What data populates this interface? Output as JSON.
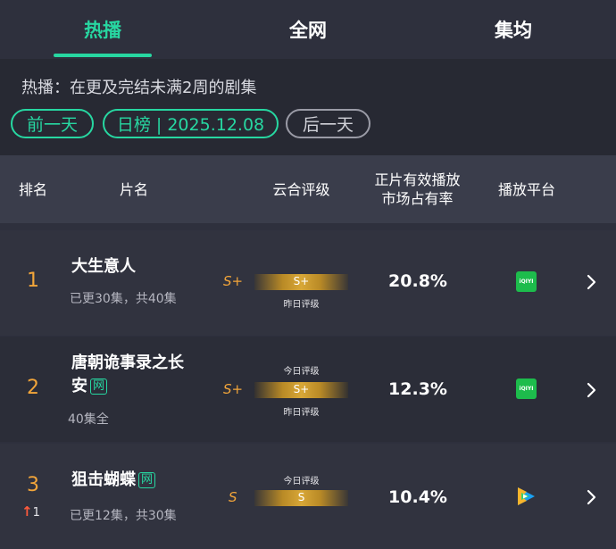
{
  "tabs": [
    {
      "label": "热播",
      "active": true
    },
    {
      "label": "全网",
      "active": false
    },
    {
      "label": "集均",
      "active": false
    }
  ],
  "info": {
    "description": "热播：在更及完结未满2周的剧集",
    "prev_day": "前一天",
    "date_label": "日榜 | 2025.12.08",
    "next_day": "后一天"
  },
  "table_header": {
    "rank": "排名",
    "title": "片名",
    "rating": "云合评级",
    "share_line1": "正片有效播放",
    "share_line2": "市场占有率",
    "platform": "播放平台"
  },
  "rows": [
    {
      "rank": "1",
      "title_line1": "大生意人",
      "title_line2": "",
      "badge": "",
      "sub": "已更30集，共40集",
      "grade_left": "S+",
      "grade_bar": "S+",
      "caption_top": "",
      "caption_bottom": "昨日评级",
      "share": "20.8%",
      "platform": "iqiyi-icon",
      "platform_label": "iQIYI"
    },
    {
      "rank": "2",
      "title_line1": "唐朝诡事录之长",
      "title_line2": "安",
      "badge": "网",
      "sub": "40集全",
      "grade_left": "S+",
      "grade_bar": "S+",
      "caption_top": "今日评级",
      "caption_bottom": "昨日评级",
      "share": "12.3%",
      "platform": "iqiyi-icon",
      "platform_label": "iQIYI"
    },
    {
      "rank": "3",
      "rank_change": "1",
      "title_line1": "狙击蝴蝶",
      "badge": "网",
      "sub": "已更12集，共30集",
      "grade_left": "S",
      "grade_bar": "S",
      "caption_top": "今日评级",
      "share": "10.4%",
      "platform": "tencent-video-icon"
    }
  ],
  "colors": {
    "accent": "#27d7a1",
    "rank": "#f2a53a",
    "background": "#2e303d"
  }
}
